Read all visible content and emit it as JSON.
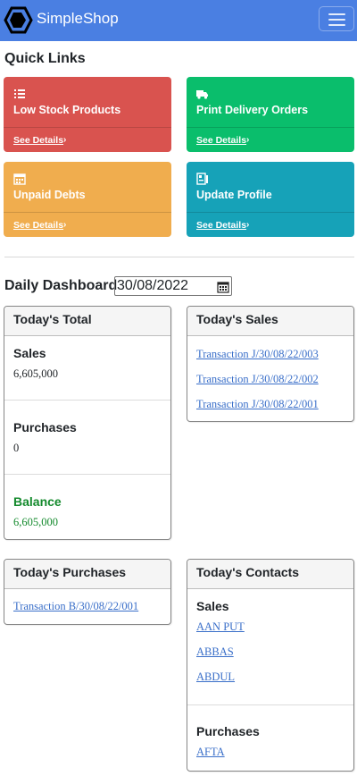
{
  "navbar": {
    "brand": "SimpleShop",
    "brand_icon": "hexagon-logo-icon",
    "menu_icon": "hamburger-menu-icon"
  },
  "quick_links": {
    "heading": "Quick Links",
    "cards": [
      {
        "title": "Low Stock Products",
        "link": "See Details",
        "icon": "list-icon",
        "color": "#d9534f"
      },
      {
        "title": "Print Delivery Orders",
        "link": "See Details",
        "icon": "truck-icon",
        "color": "#0abe6c"
      },
      {
        "title": "Unpaid Debts",
        "link": "See Details",
        "icon": "calendar-icon",
        "color": "#f0ad4e"
      },
      {
        "title": "Update Profile",
        "link": "See Details",
        "icon": "id-card-icon",
        "color": "#16a2b8"
      }
    ]
  },
  "daily": {
    "heading": "Daily Dashboard",
    "date": "30/08/2022"
  },
  "total": {
    "header": "Today's Total",
    "sales_label": "Sales",
    "sales_value": "6,605,000",
    "purchases_label": "Purchases",
    "purchases_value": "0",
    "balance_label": "Balance",
    "balance_value": "6,605,000"
  },
  "sales": {
    "header": "Today's Sales",
    "transactions": [
      "Transaction J/30/08/22/003",
      "Transaction J/30/08/22/002",
      "Transaction J/30/08/22/001"
    ]
  },
  "purchases": {
    "header": "Today's Purchases",
    "transactions": [
      "Transaction B/30/08/22/001"
    ]
  },
  "contacts": {
    "header": "Today's Contacts",
    "sales_label": "Sales",
    "sales_contacts": [
      "AAN PUT",
      "ABBAS",
      "ABDUL"
    ],
    "purchases_label": "Purchases",
    "purchases_contacts": [
      "AFTA"
    ]
  }
}
